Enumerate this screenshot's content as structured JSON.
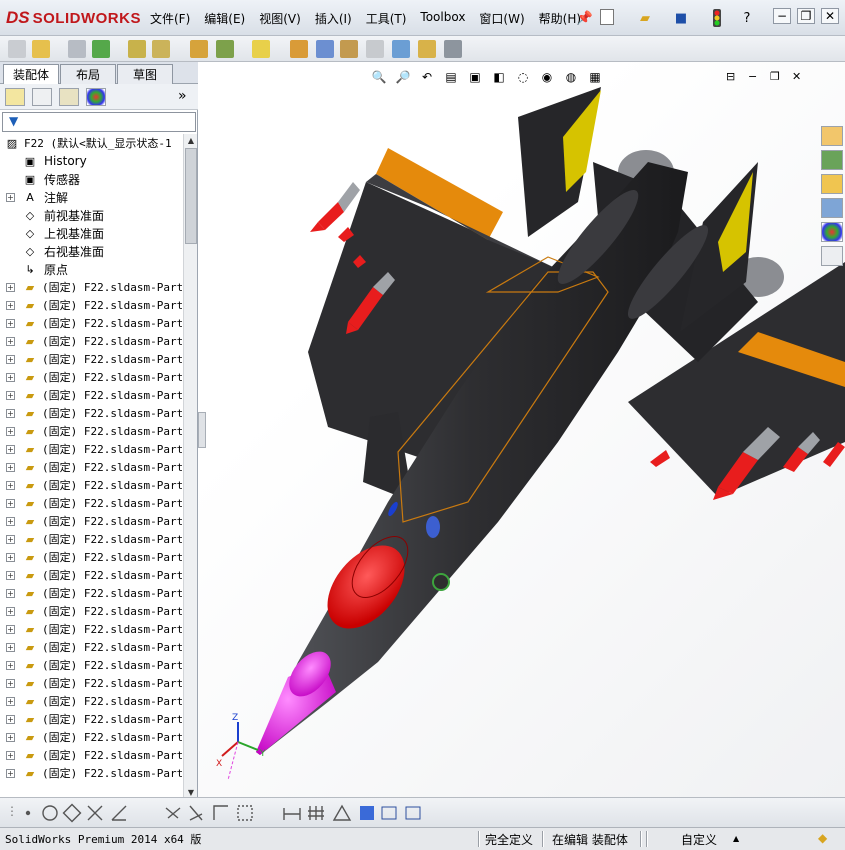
{
  "app": {
    "logo_ds": "DS",
    "logo_text": "SOLIDWORKS"
  },
  "menu": [
    "文件(F)",
    "编辑(E)",
    "视图(V)",
    "插入(I)",
    "工具(T)",
    "Toolbox",
    "窗口(W)",
    "帮助(H)"
  ],
  "title_controls": {
    "help": "?",
    "minimize": "□",
    "restore": "◻",
    "close": "✕"
  },
  "tabs": [
    "装配体",
    "布局",
    "草图"
  ],
  "panel": {
    "expand_glyph": "»"
  },
  "tree": {
    "root": "F22  (默认<默认_显示状态-1",
    "features": [
      {
        "label": "History",
        "icon": "history-icon"
      },
      {
        "label": "传感器",
        "icon": "sensor-icon"
      },
      {
        "label": "注解",
        "icon": "annotation-icon"
      },
      {
        "label": "前视基准面",
        "icon": "plane-icon"
      },
      {
        "label": "上视基准面",
        "icon": "plane-icon"
      },
      {
        "label": "右视基准面",
        "icon": "plane-icon"
      },
      {
        "label": "原点",
        "icon": "origin-icon"
      }
    ],
    "part_label": "(固定) F22.sldasm-Part-",
    "part_count": 28
  },
  "triad": {
    "x": "X",
    "y": "Y",
    "z": "Z"
  },
  "status": {
    "product": "SolidWorks Premium 2014 x64 版",
    "definition": "完全定义",
    "editing": "在编辑 装配体",
    "units": "自定义",
    "units_arrow": "▲"
  },
  "colors": {
    "fuselage": "#2e2e31",
    "nose": "#e010e0",
    "canopy": "#f01010",
    "stripe": "#e58a0c",
    "fin": "#d6c300",
    "missile": "#e81d1d"
  }
}
